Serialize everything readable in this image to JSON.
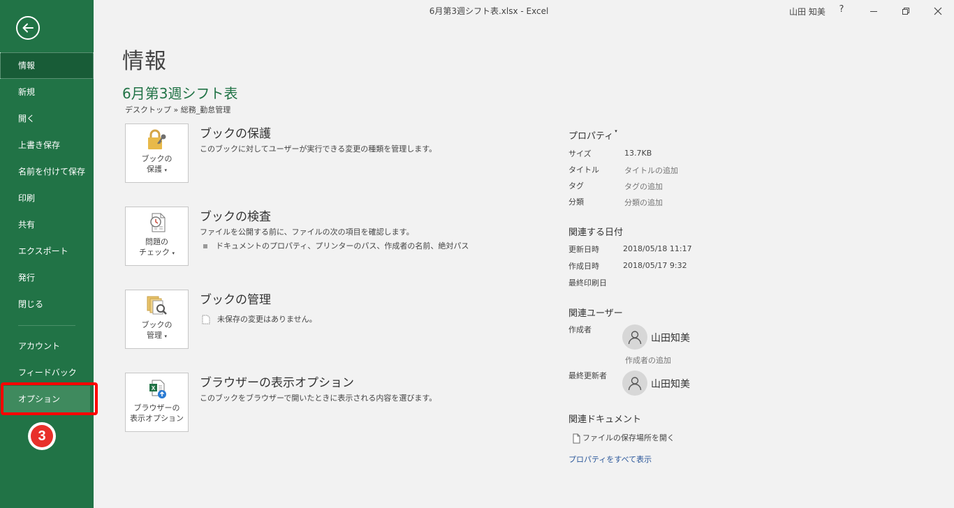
{
  "window": {
    "title": "6月第3週シフト表.xlsx  -  Excel",
    "user": "山田 知美",
    "help": "?"
  },
  "sidebar": {
    "items": [
      {
        "label": "情報"
      },
      {
        "label": "新規"
      },
      {
        "label": "開く"
      },
      {
        "label": "上書き保存"
      },
      {
        "label": "名前を付けて保存"
      },
      {
        "label": "印刷"
      },
      {
        "label": "共有"
      },
      {
        "label": "エクスポート"
      },
      {
        "label": "発行"
      },
      {
        "label": "閉じる"
      }
    ],
    "lower_items": [
      {
        "label": "アカウント"
      },
      {
        "label": "フィードバック"
      },
      {
        "label": "オプション"
      }
    ],
    "step_badge": "3"
  },
  "main": {
    "page_title": "情報",
    "doc_title": "6月第3週シフト表",
    "doc_path": "デスクトップ » 総務_勤怠管理",
    "sections": {
      "protect": {
        "tile_line1": "ブックの",
        "tile_line2": "保護",
        "title": "ブックの保護",
        "desc": "このブックに対してユーザーが実行できる変更の種類を管理します。"
      },
      "inspect": {
        "tile_line1": "問題の",
        "tile_line2": "チェック",
        "title": "ブックの検査",
        "desc": "ファイルを公開する前に、ファイルの次の項目を確認します。",
        "bullet": "ドキュメントのプロパティ、プリンターのパス、作成者の名前、絶対パス"
      },
      "manage": {
        "tile_line1": "ブックの",
        "tile_line2": "管理",
        "title": "ブックの管理",
        "desc": "未保存の変更はありません。"
      },
      "browser": {
        "tile_line1": "ブラウザーの",
        "tile_line2": "表示オプション",
        "title": "ブラウザーの表示オプション",
        "desc": "このブックをブラウザーで開いたときに表示される内容を選びます。"
      }
    }
  },
  "properties": {
    "header": "プロパティ",
    "size_label": "サイズ",
    "size_value": "13.7KB",
    "title_label": "タイトル",
    "title_value": "タイトルの追加",
    "tag_label": "タグ",
    "tag_value": "タグの追加",
    "category_label": "分類",
    "category_value": "分類の追加",
    "dates_header": "関連する日付",
    "modified_label": "更新日時",
    "modified_value": "2018/05/18 11:17",
    "created_label": "作成日時",
    "created_value": "2018/05/17 9:32",
    "printed_label": "最終印刷日",
    "people_header": "関連ユーザー",
    "author_label": "作成者",
    "author_name": "山田知美",
    "add_author": "作成者の追加",
    "last_modified_by_label": "最終更新者",
    "last_modified_by_name": "山田知美",
    "docs_header": "関連ドキュメント",
    "open_location": "ファイルの保存場所を開く",
    "show_all": "プロパティをすべて表示"
  },
  "colors": {
    "accent": "#217346",
    "sidebar_active": "#185c37",
    "highlight_box": "#ff0000",
    "badge": "#e8302a",
    "link": "#2b579a"
  }
}
